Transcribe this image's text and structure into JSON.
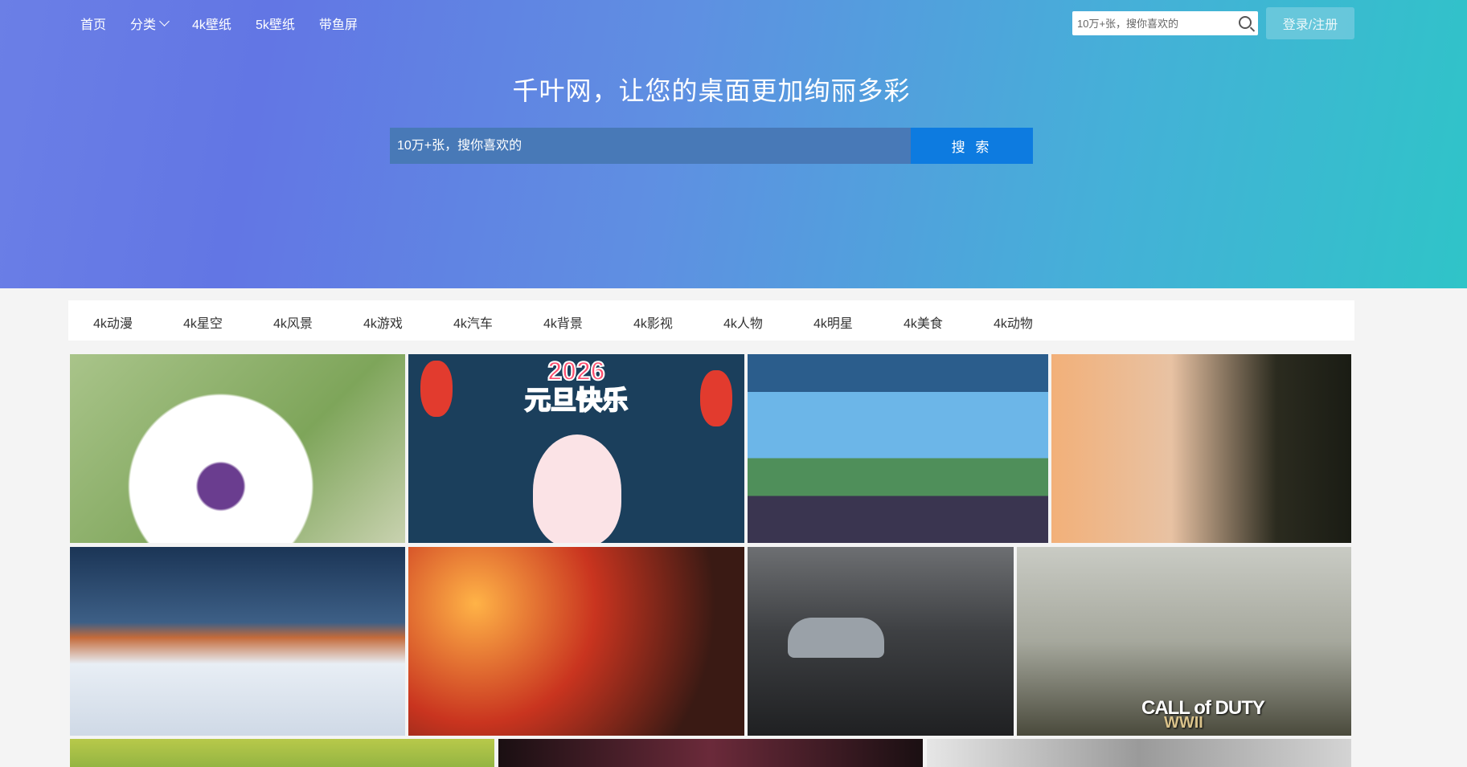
{
  "nav": {
    "items": [
      "首页",
      "分类",
      "4k壁纸",
      "5k壁纸",
      "带鱼屏"
    ]
  },
  "header": {
    "search_placeholder": "10万+张，搜你喜欢的",
    "login_label": "登录/注册"
  },
  "hero": {
    "slogan": "千叶网，让您的桌面更加绚丽多彩",
    "search_placeholder": "10万+张，搜你喜欢的",
    "search_button": "搜 索"
  },
  "categories": [
    "4k动漫",
    "4k星空",
    "4k风景",
    "4k游戏",
    "4k汽车",
    "4k背景",
    "4k影视",
    "4k人物",
    "4k明星",
    "4k美食",
    "4k动物"
  ],
  "thumbnails": {
    "newyear_text": "2026\n元旦快乐",
    "cod_title": "CALL of DUTY",
    "cod_sub": "WWII"
  },
  "colors": {
    "hero_start": "#6b7fe6",
    "hero_end": "#2fc4c8",
    "search_button": "#0d7be0",
    "login_button": "#6cc9dd"
  }
}
